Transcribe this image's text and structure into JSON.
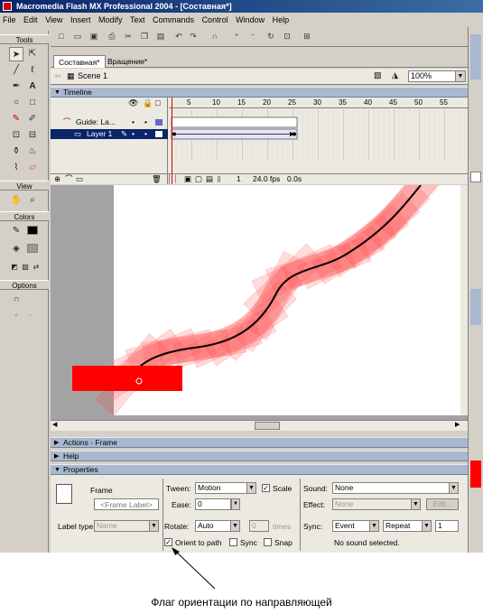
{
  "window": {
    "title": "Macromedia Flash MX Professional 2004 - [Составная*]"
  },
  "menu": [
    "File",
    "Edit",
    "View",
    "Insert",
    "Modify",
    "Text",
    "Commands",
    "Control",
    "Window",
    "Help"
  ],
  "tools": {
    "header": "Tools",
    "view_header": "View",
    "colors_header": "Colors",
    "options_header": "Options"
  },
  "doc_tabs": [
    "Составная*",
    "Вращение*"
  ],
  "scene": {
    "label": "Scene 1",
    "zoom": "100%"
  },
  "timeline": {
    "title": "Timeline",
    "ruler": [
      "5",
      "10",
      "15",
      "20",
      "25",
      "30",
      "35",
      "40",
      "45",
      "50",
      "55"
    ],
    "layers": [
      {
        "name": "Guide: La..."
      },
      {
        "name": "Layer 1"
      }
    ],
    "current_frame": "1",
    "fps": "24.0 fps",
    "elapsed": "0.0s"
  },
  "panels": {
    "actions": "Actions - Frame",
    "help": "Help",
    "properties": "Properties"
  },
  "properties": {
    "frame_label": "Frame",
    "frame_label_placeholder": "<Frame Label>",
    "label_type": "Label type:",
    "label_type_value": "Name",
    "tween_label": "Tween:",
    "tween_value": "Motion",
    "scale_label": "Scale",
    "ease_label": "Ease:",
    "ease_value": "0",
    "rotate_label": "Rotate:",
    "rotate_value": "Auto",
    "times_value": "0",
    "times_label": "times",
    "orient_label": "Orient to path",
    "sync_check_label": "Sync",
    "snap_label": "Snap",
    "sound_label": "Sound:",
    "sound_value": "None",
    "effect_label": "Effect:",
    "effect_value": "None",
    "edit_button": "Edit...",
    "sync_label": "Sync:",
    "sync_value": "Event",
    "repeat_value": "Repeat",
    "repeat_count": "1",
    "status": "No sound selected."
  },
  "caption": "Флаг ориентации по направляющей",
  "colors": {
    "titlebar": "#0a246a",
    "panel": "#a9b8cf",
    "rect_fill": "#ff0000",
    "stage": "#ffffff"
  }
}
